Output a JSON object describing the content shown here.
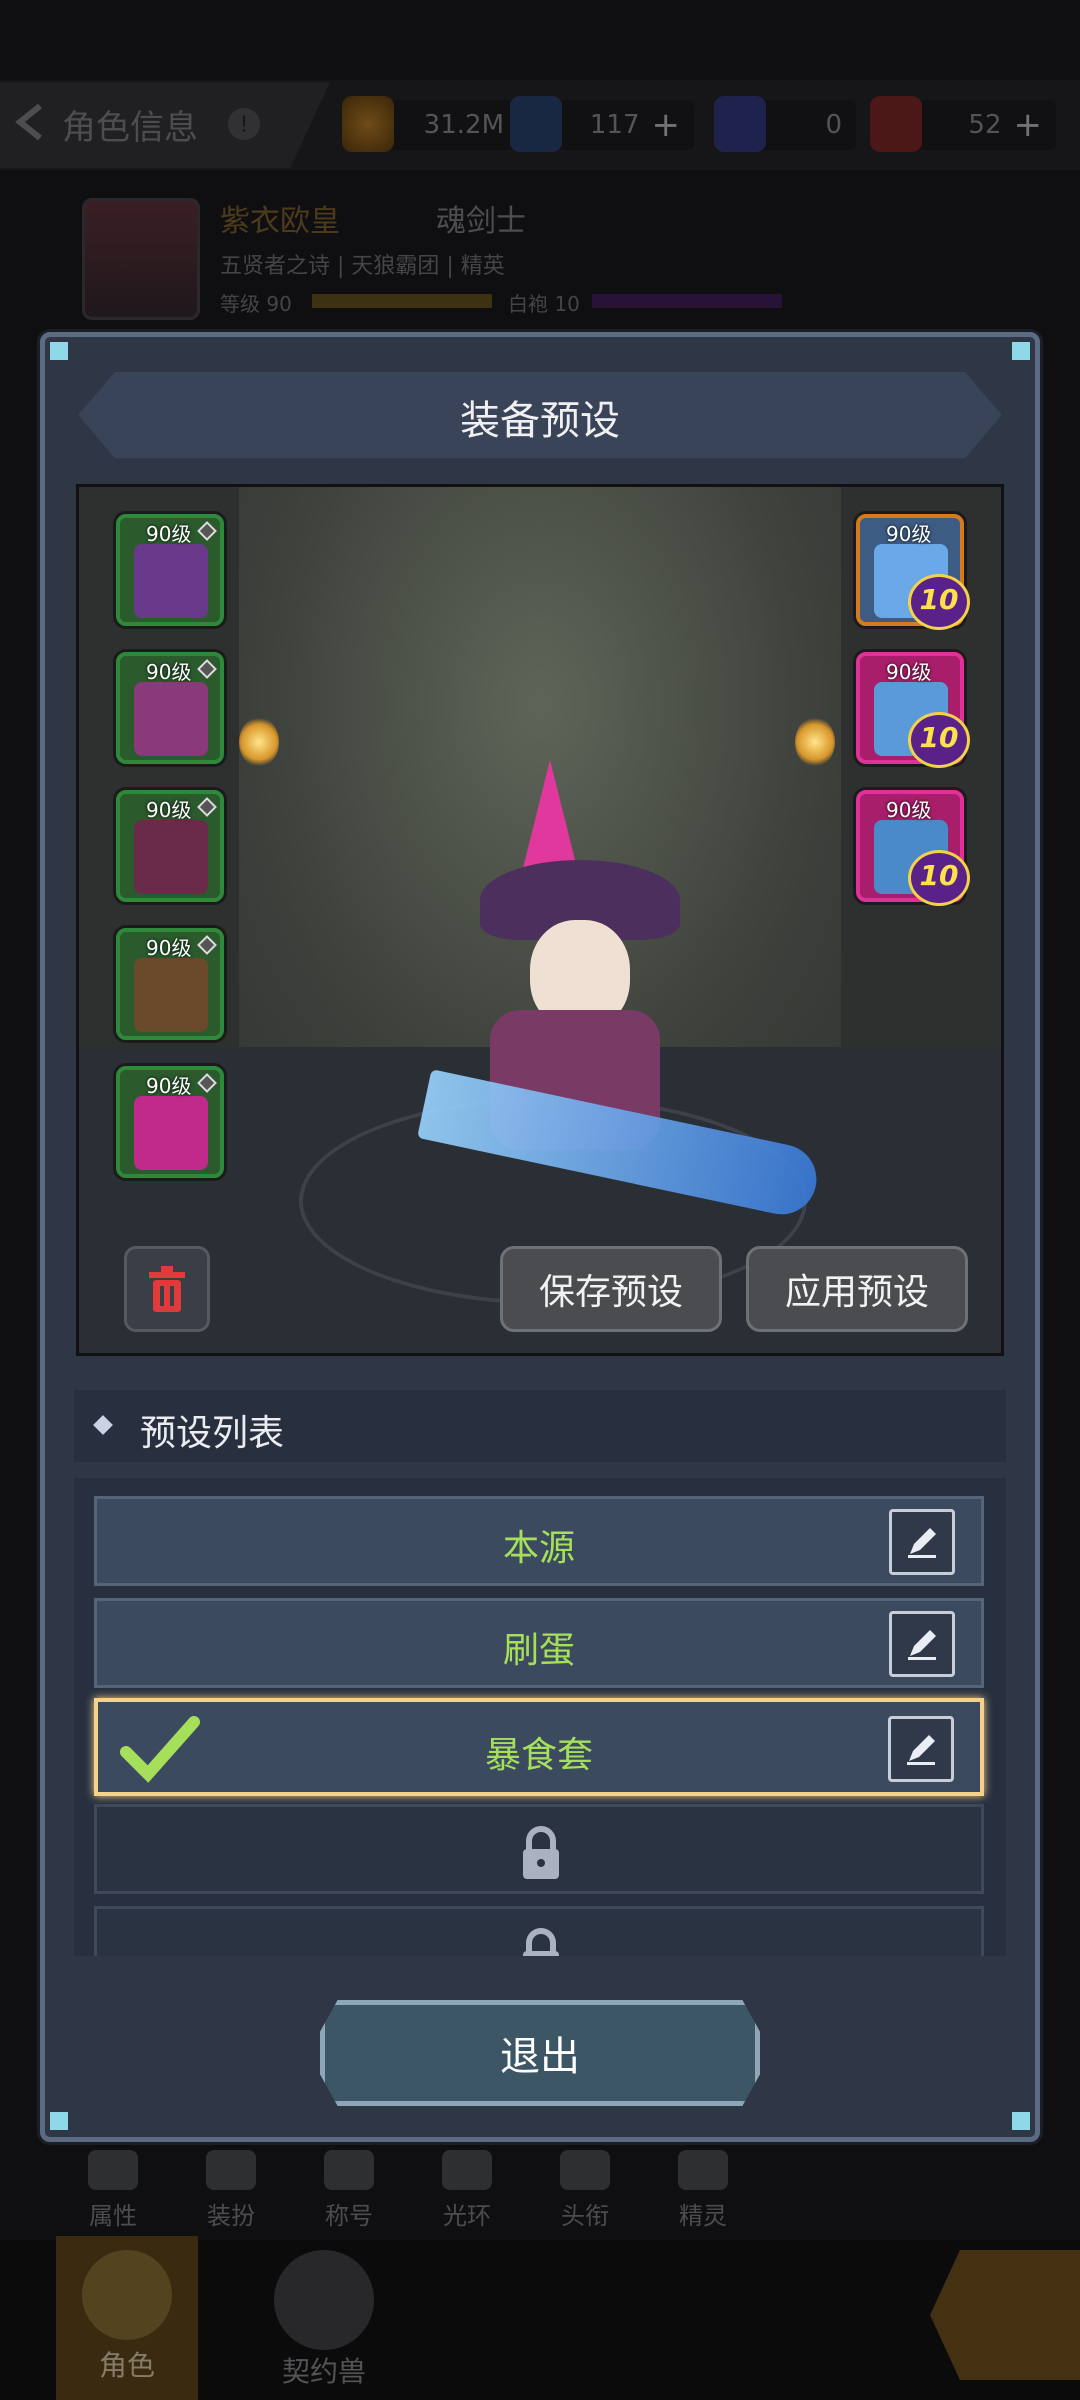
{
  "header": {
    "title": "角色信息",
    "currencies": [
      {
        "icon": "gold-coin-icon",
        "value": "31.2M",
        "plus": false
      },
      {
        "icon": "crystal-icon",
        "value": "117",
        "plus": true
      },
      {
        "icon": "ticket-icon",
        "value": "0",
        "plus": false
      },
      {
        "icon": "red-ticket-icon",
        "value": "52",
        "plus": true
      }
    ]
  },
  "character": {
    "name": "紫衣欧皇",
    "class": "魂剑士",
    "guild_line": "五贤者之诗 | 天狼霸团 | 精英",
    "level_label": "等级 90",
    "robe_label": "白袍 10"
  },
  "modal": {
    "title": "装备预设",
    "left_slots": [
      {
        "level": "90级",
        "item": "hat-icon"
      },
      {
        "level": "90级",
        "item": "armor-icon"
      },
      {
        "level": "90级",
        "item": "pants-icon"
      },
      {
        "level": "90级",
        "item": "gloves-icon"
      },
      {
        "level": "90级",
        "item": "cape-icon"
      }
    ],
    "right_slots": [
      {
        "level": "90级",
        "item": "sword-icon",
        "enhance": "10",
        "frame": "orange"
      },
      {
        "level": "90级",
        "item": "crystal-weapon-icon",
        "enhance": "10",
        "frame": "pink"
      },
      {
        "level": "90级",
        "item": "crystal-weapon-icon",
        "enhance": "10",
        "frame": "pink"
      }
    ],
    "save_button": "保存预设",
    "apply_button": "应用预设",
    "list_title": "预设列表",
    "presets": [
      {
        "label": "本源",
        "locked": false,
        "selected": false
      },
      {
        "label": "刷蛋",
        "locked": false,
        "selected": false
      },
      {
        "label": "暴食套",
        "locked": false,
        "selected": true
      },
      {
        "label": "",
        "locked": true,
        "selected": false
      },
      {
        "label": "",
        "locked": true,
        "selected": false
      }
    ],
    "exit_button": "退出"
  },
  "tabs": [
    "属性",
    "装扮",
    "称号",
    "光环",
    "头衔",
    "精灵"
  ],
  "nav": [
    "角色",
    "契约兽"
  ],
  "colors": {
    "preset_label": "#a6e05a",
    "selection_border": "#f4d28a",
    "modal_bg": "#2f3646"
  }
}
